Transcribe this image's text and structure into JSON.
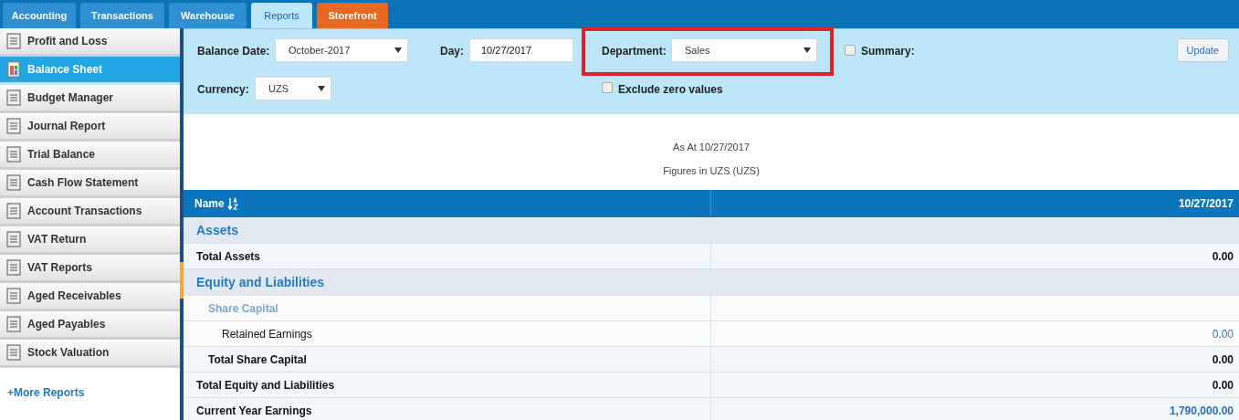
{
  "tabs": [
    {
      "label": "Accounting",
      "selected": false,
      "kind": "normal"
    },
    {
      "label": "Transactions",
      "selected": false,
      "kind": "normal"
    },
    {
      "label": "Warehouse",
      "selected": false,
      "kind": "normal"
    },
    {
      "label": "Reports",
      "selected": true,
      "kind": "normal"
    },
    {
      "label": "Storefront",
      "selected": false,
      "kind": "accent"
    }
  ],
  "sidebar": {
    "items": [
      {
        "label": "Profit and Loss",
        "selected": false
      },
      {
        "label": "Balance Sheet",
        "selected": true
      },
      {
        "label": "Budget Manager",
        "selected": false
      },
      {
        "label": "Journal Report",
        "selected": false
      },
      {
        "label": "Trial Balance",
        "selected": false
      },
      {
        "label": "Cash Flow Statement",
        "selected": false
      },
      {
        "label": "Account Transactions",
        "selected": false
      },
      {
        "label": "VAT Return",
        "selected": false
      },
      {
        "label": "VAT Reports",
        "selected": false
      },
      {
        "label": "Aged Receivables",
        "selected": false
      },
      {
        "label": "Aged Payables",
        "selected": false
      },
      {
        "label": "Stock Valuation",
        "selected": false
      }
    ],
    "more_link": "+More Reports"
  },
  "filters": {
    "balance_date": {
      "label": "Balance Date:",
      "value": "October-2017"
    },
    "day": {
      "label": "Day:",
      "value": "10/27/2017"
    },
    "department": {
      "label": "Department:",
      "value": "Sales",
      "highlighted": true
    },
    "summary": {
      "label": "Summary:",
      "checked": false
    },
    "update_button": "Update",
    "currency": {
      "label": "Currency:",
      "value": "UZS"
    },
    "exclude_zero": {
      "label": "Exclude zero values",
      "checked": false
    }
  },
  "report": {
    "as_at": "As At 10/27/2017",
    "figures_in": "Figures in UZS (UZS)"
  },
  "table": {
    "columns": [
      "Name",
      "10/27/2017"
    ],
    "rows": [
      {
        "kind": "section",
        "name": "Assets"
      },
      {
        "kind": "total",
        "name": "Total Assets",
        "value": "0.00"
      },
      {
        "kind": "section",
        "name": "Equity and Liabilities"
      },
      {
        "kind": "group",
        "name": "Share Capital"
      },
      {
        "kind": "account",
        "name": "Retained Earnings",
        "value": "0.00"
      },
      {
        "kind": "subtotal",
        "name": "Total Share Capital",
        "value": "0.00"
      },
      {
        "kind": "total",
        "name": "Total Equity and Liabilities",
        "value": "0.00"
      },
      {
        "kind": "earnings",
        "name": "Current Year Earnings",
        "value": "1,790,000.00"
      }
    ]
  }
}
